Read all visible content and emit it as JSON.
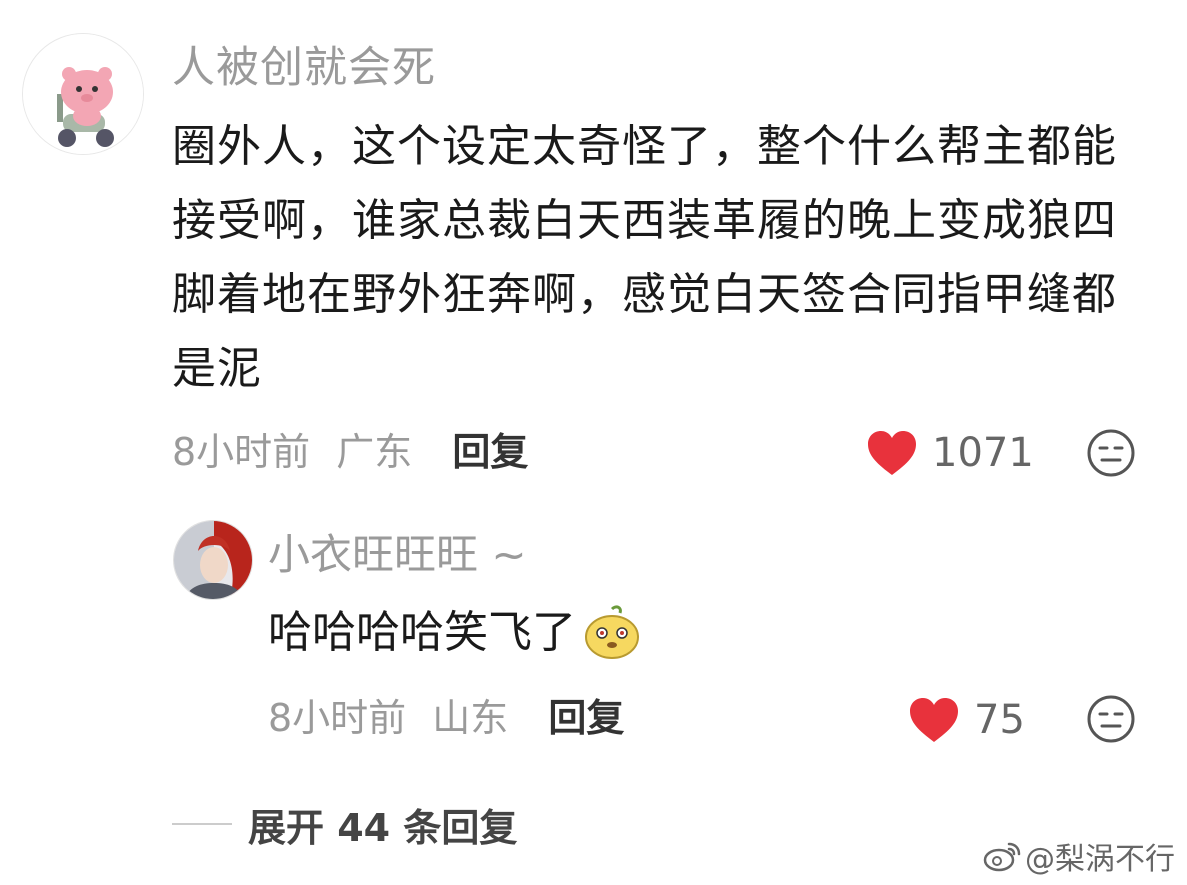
{
  "comment": {
    "username": "人被创就会死",
    "avatar_icon": "pink-bear-on-scooter",
    "text": "圈外人，这个设定太奇怪了，整个什么帮主都能接受啊，谁家总裁白天西装革履的晚上变成狼四脚着地在野外狂奔啊，感觉白天签合同指甲缝都是泥",
    "time": "8小时前",
    "location": "广东",
    "reply_label": "回复",
    "likes": "1071",
    "more_icon": "meh-face-icon"
  },
  "reply": {
    "username": "小衣旺旺旺 ~",
    "avatar_icon": "red-hair-character",
    "text": "哈哈哈哈笑飞了",
    "emoji": "yellow-blob-emoji",
    "time": "8小时前",
    "location": "山东",
    "reply_label": "回复",
    "likes": "75",
    "more_icon": "meh-face-icon"
  },
  "expand": {
    "label": "展开 44 条回复"
  },
  "watermark": {
    "text": "@梨涡不行",
    "icon": "weibo-icon"
  },
  "colors": {
    "heart": "#e8323c",
    "muted": "#9a9a9a",
    "body": "#1a1a1a"
  }
}
